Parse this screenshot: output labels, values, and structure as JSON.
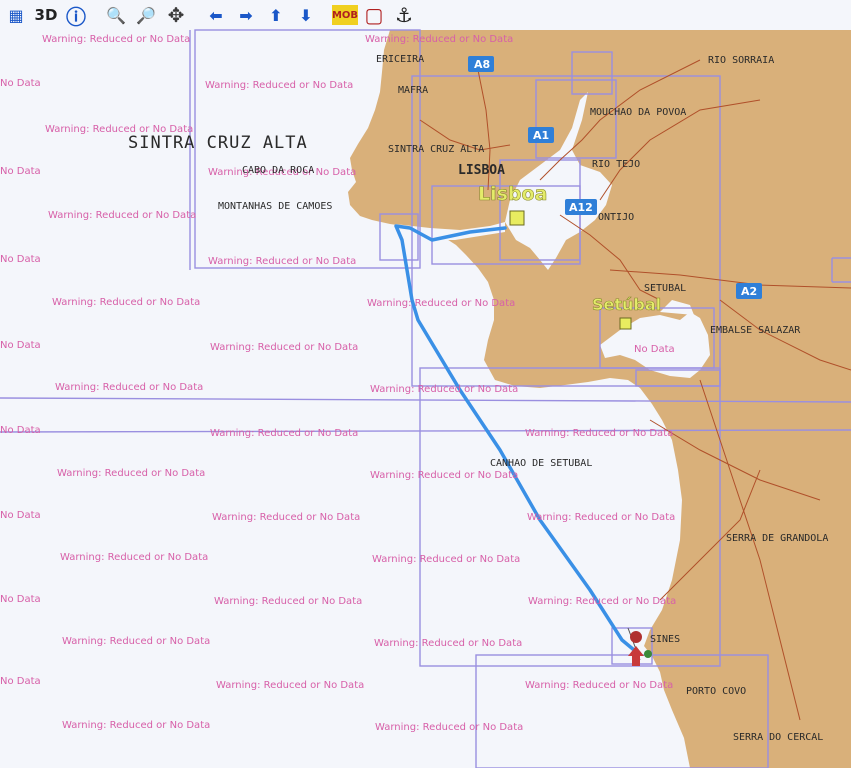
{
  "toolbar": {
    "buttons": [
      {
        "name": "layers-button",
        "glyph": "▦"
      },
      {
        "name": "view-3d-button",
        "glyph": "3D"
      },
      {
        "name": "info-button",
        "glyph": "ⓘ"
      },
      {
        "name": "zoom-out-button",
        "glyph": "🔍"
      },
      {
        "name": "zoom-in-button",
        "glyph": "🔎"
      },
      {
        "name": "pan-button",
        "glyph": "✥"
      },
      {
        "name": "move-left-button",
        "glyph": "⬅"
      },
      {
        "name": "move-right-button",
        "glyph": "➡"
      },
      {
        "name": "move-up-button",
        "glyph": "⬆"
      },
      {
        "name": "move-down-button",
        "glyph": "⬇"
      },
      {
        "name": "mob-button",
        "glyph": "MOB"
      },
      {
        "name": "stop-button",
        "glyph": "▢"
      },
      {
        "name": "anchor-button",
        "glyph": "⚓"
      }
    ]
  },
  "warning_text": "Warning: Reduced or No Data",
  "warning_short": "No Data",
  "places": {
    "sintra_big": "SINTRA CRUZ ALTA",
    "ericeira": "ERICEIRA",
    "mafra": "MAFRA",
    "rio_sorraia": "RIO SORRAIA",
    "mouchao": "MOUCHAO DA POVOA",
    "sintra_small": "SINTRA CRUZ ALTA",
    "lisboa_small": "LISBOA",
    "rio_tejo": "RIO TEJO",
    "cabo_roca": "CABO DA ROCA",
    "montanhas": "MONTANHAS DE CAMOES",
    "montijo": "ONTIJO",
    "setubal_small": "SETUBAL",
    "embalse": "EMBALSE SALAZAR",
    "canhao": "CANHAO DE SETUBAL",
    "serra_grandola": "SERRA DE GRANDOLA",
    "sines": "SINES",
    "porto_covo": "PORTO COVO",
    "serra_cercal": "SERRA DO CERCAL"
  },
  "cities": {
    "lisboa": "Lisboa",
    "setubal": "Setúbal"
  },
  "roads": {
    "a8": "A8",
    "a1": "A1",
    "a12": "A12",
    "a2": "A2"
  },
  "colors": {
    "land": "#d9b07a",
    "sea": "#f4f6fb",
    "route": "#3a90e6",
    "boundary": "#9a8fe0",
    "warning": "#d75fa8",
    "road_shield": "#2f7fd8",
    "city_marker": "#e8ec60"
  }
}
